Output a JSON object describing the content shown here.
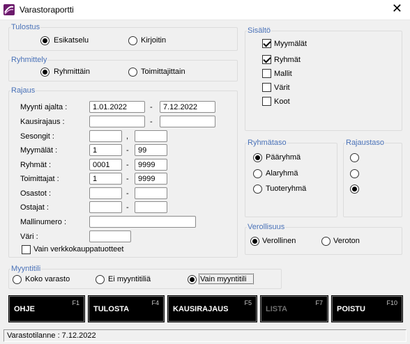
{
  "window": {
    "title": "Varastoraportti",
    "close_glyph": "✕"
  },
  "tulostus": {
    "legend": "Tulostus",
    "options": [
      {
        "label": "Esikatselu",
        "selected": true
      },
      {
        "label": "Kirjoitin",
        "selected": false
      }
    ]
  },
  "ryhmittely": {
    "legend": "Ryhmittely",
    "options": [
      {
        "label": "Ryhmittäin",
        "selected": true
      },
      {
        "label": "Toimittajittain",
        "selected": false
      }
    ]
  },
  "rajaus": {
    "legend": "Rajaus",
    "rows": [
      {
        "label": "Myynti ajalta :",
        "from": "1.01.2022",
        "sep": "-",
        "to": "7.12.2022"
      },
      {
        "label": "Kausirajaus :",
        "from": "",
        "sep": "-",
        "to": ""
      },
      {
        "label": "Sesongit :",
        "from": "",
        "sep": ",",
        "to": ""
      },
      {
        "label": "Myymälät :",
        "from": "1",
        "sep": "-",
        "to": "99"
      },
      {
        "label": "Ryhmät :",
        "from": "0001",
        "sep": "-",
        "to": "9999"
      },
      {
        "label": "Toimittajat :",
        "from": "1",
        "sep": "-",
        "to": "9999"
      },
      {
        "label": "Osastot :",
        "from": "",
        "sep": "-",
        "to": ""
      },
      {
        "label": "Ostajat :",
        "from": "",
        "sep": "-",
        "to": ""
      }
    ],
    "mallinumero_label": "Mallinumero :",
    "mallinumero_value": "",
    "vari_label": "Väri :",
    "vari_value": "",
    "verkko_label": "Vain verkkokauppatuotteet",
    "verkko_checked": false
  },
  "sisalto": {
    "legend": "Sisältö",
    "items": [
      {
        "label": "Myymälät",
        "checked": true
      },
      {
        "label": "Ryhmät",
        "checked": true
      },
      {
        "label": "Mallit",
        "checked": false
      },
      {
        "label": "Värit",
        "checked": false
      },
      {
        "label": "Koot",
        "checked": false
      }
    ]
  },
  "ryhmataso": {
    "legend": "Ryhmätaso",
    "options": [
      {
        "label": "Pääryhmä",
        "selected": true
      },
      {
        "label": "Alaryhmä",
        "selected": false
      },
      {
        "label": "Tuoteryhmä",
        "selected": false
      }
    ]
  },
  "rajaustaso": {
    "legend": "Rajaustaso",
    "options": [
      {
        "selected": false
      },
      {
        "selected": false
      },
      {
        "selected": true
      }
    ]
  },
  "verollisuus": {
    "legend": "Verollisuus",
    "options": [
      {
        "label": "Verollinen",
        "selected": true
      },
      {
        "label": "Veroton",
        "selected": false
      }
    ]
  },
  "myyntitili": {
    "legend": "Myyntitili",
    "options": [
      {
        "label": "Koko varasto",
        "selected": false
      },
      {
        "label": "Ei myyntitiliä",
        "selected": false
      },
      {
        "label": "Vain myyntitili",
        "selected": true
      }
    ]
  },
  "buttons": [
    {
      "label": "OHJE",
      "key": "F1",
      "disabled": false
    },
    {
      "label": "TULOSTA",
      "key": "F4",
      "disabled": false
    },
    {
      "label": "KAUSIRAJAUS",
      "key": "F5",
      "disabled": false
    },
    {
      "label": "LISTA",
      "key": "F7",
      "disabled": true
    },
    {
      "label": "POISTU",
      "key": "F10",
      "disabled": false
    }
  ],
  "status": {
    "text": "Varastotilanne :  7.12.2022"
  },
  "colors": {
    "legend": "#4a72b8",
    "button_bg": "#000000",
    "button_text": "#ffffff"
  }
}
